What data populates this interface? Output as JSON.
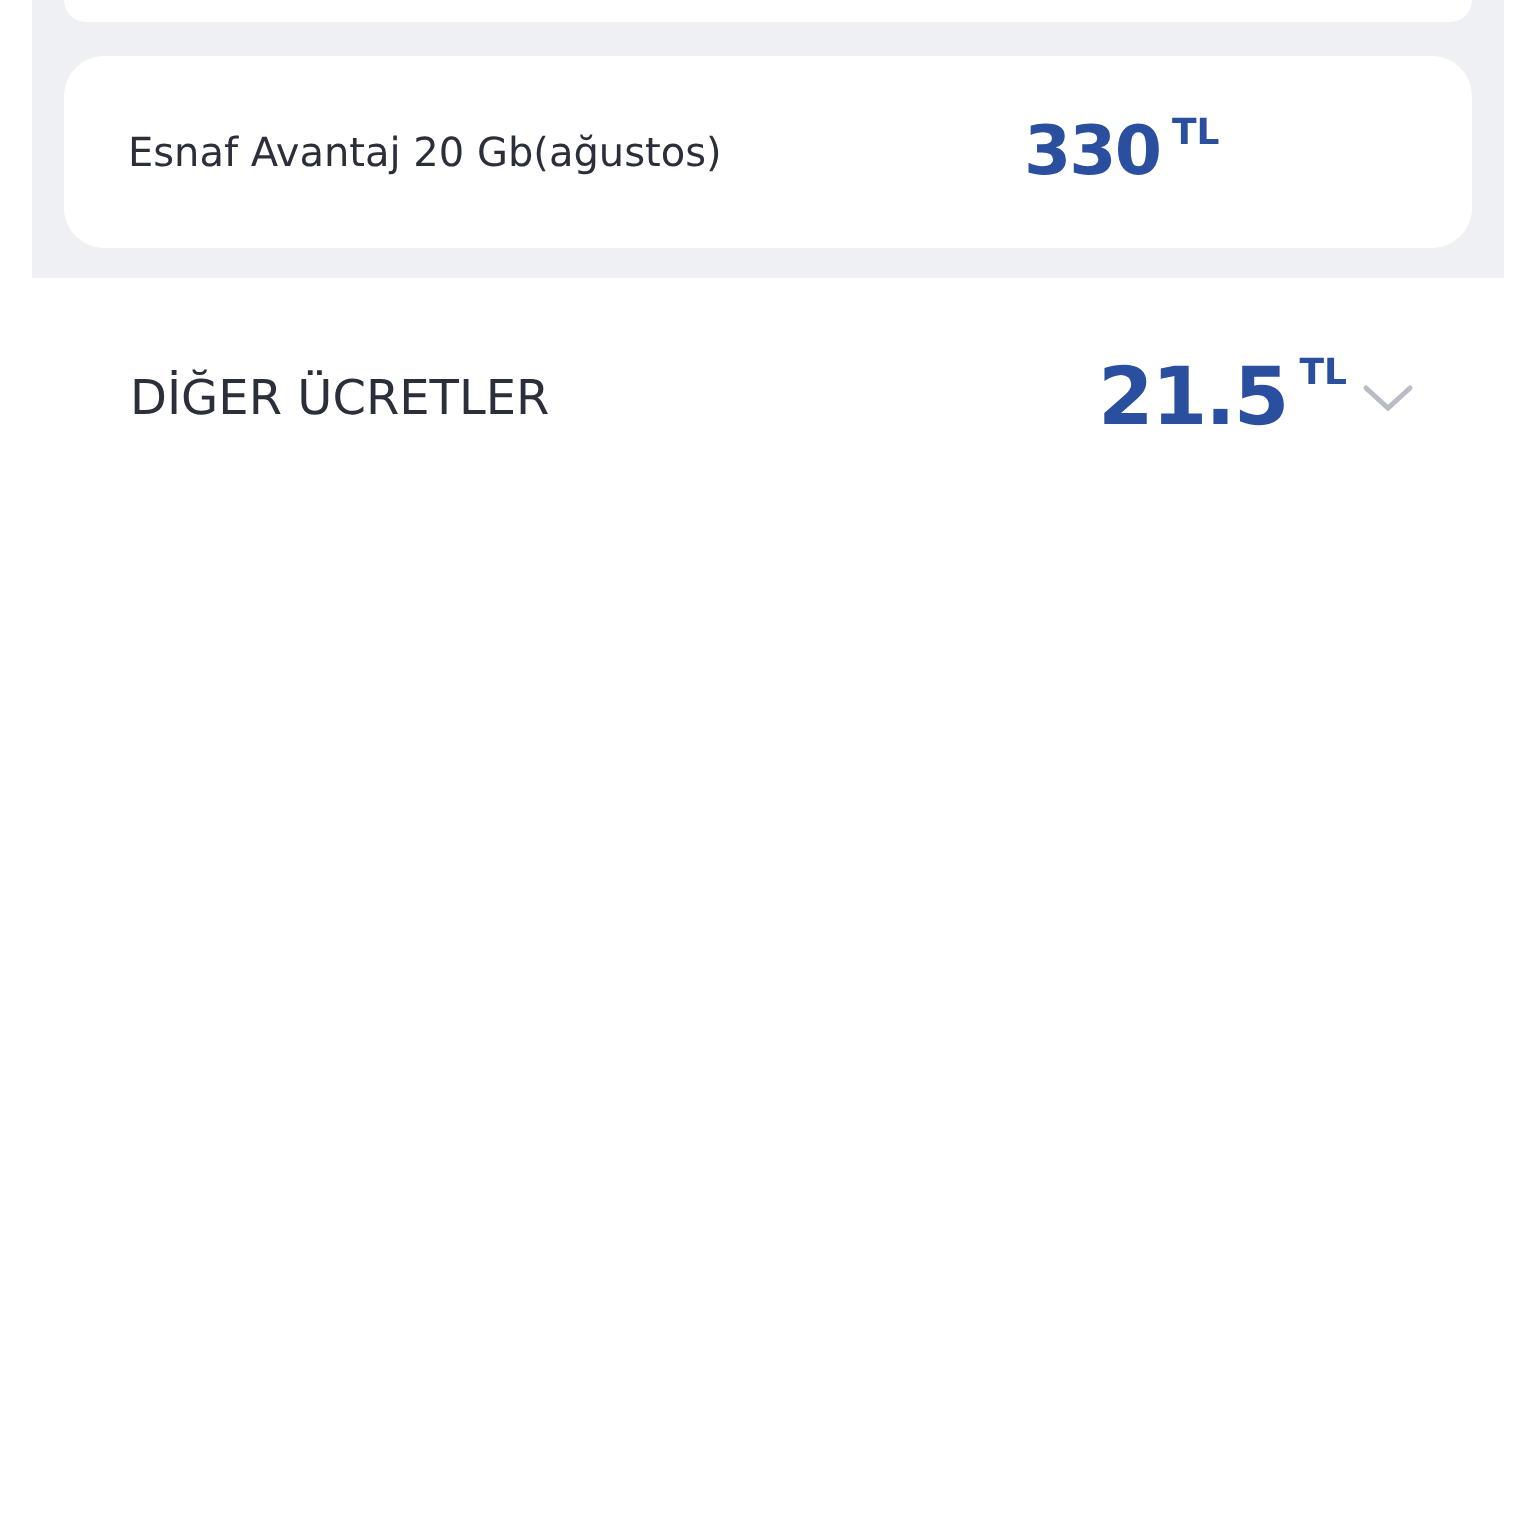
{
  "package_card": {
    "name": "Esnaf Avantaj 20 Gb(ağustos)",
    "amount": "330",
    "currency": "TL"
  },
  "other_fees": {
    "label": "DİĞER ÜCRETLER",
    "amount": "21.5",
    "currency": "TL",
    "expanded": false
  }
}
